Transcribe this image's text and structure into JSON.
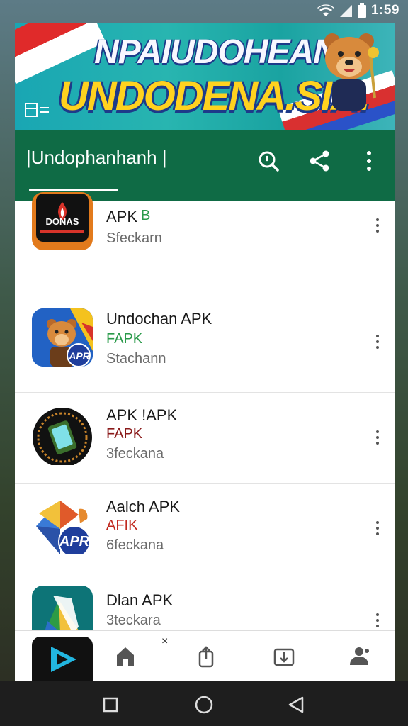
{
  "status_bar": {
    "time": "1:59",
    "wifi_icon": "wifi-icon",
    "signal_icon": "signal-icon",
    "battery_icon": "battery-icon"
  },
  "banner": {
    "line1": "NPAIUDOHEAN",
    "line2": "UNDODENA.SIA."
  },
  "toolbar": {
    "title": "|Undophanhanh |",
    "search_icon": "search-icon",
    "share_icon": "share-icon",
    "menu_icon": "more-vert-icon",
    "color": "#0f6b45"
  },
  "apps": [
    {
      "name": "APK",
      "tag": "B",
      "tag_color": "#2a9a4a",
      "sub": "Sfeckarn",
      "icon_text": "DONAS"
    },
    {
      "name": "Undochan APK",
      "tag": "FAPK",
      "tag_color": "#2a9a4a",
      "sub": "Stachann",
      "icon_text": "APR"
    },
    {
      "name": "APK !APK",
      "tag": "FAPK",
      "tag_color": "#8a1a1a",
      "sub": "3feckana"
    },
    {
      "name": "Aalch APK",
      "tag": "AFIK",
      "tag_color": "#c0281e",
      "sub": "6feckana",
      "icon_text": "APR"
    },
    {
      "name": "Dlan APK",
      "tag": "",
      "tag_color": "#2a9a4a",
      "sub": "3teckara"
    }
  ],
  "bottom_nav": {
    "close_label": "×",
    "items": [
      "play-icon",
      "home-icon",
      "share-upload-icon",
      "download-icon",
      "profile-icon"
    ]
  },
  "system_nav": {
    "items": [
      "recents-icon",
      "home-circle-icon",
      "back-icon"
    ]
  }
}
